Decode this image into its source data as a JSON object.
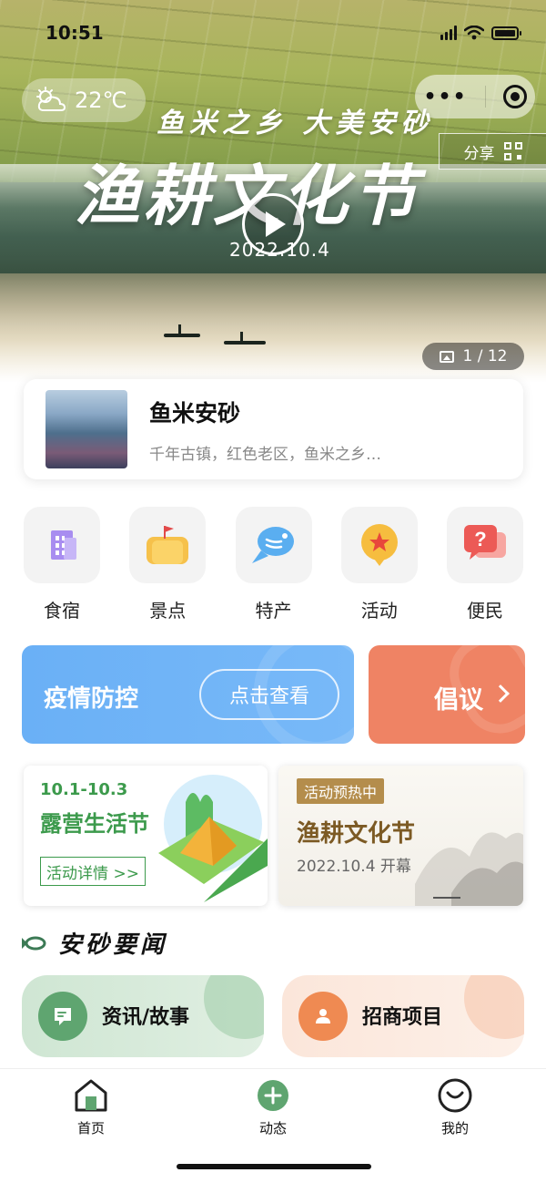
{
  "status_bar": {
    "time": "10:51"
  },
  "hero": {
    "weather_temp": "22℃",
    "share_label": "分享",
    "slogan": "鱼米之乡 大美安砂",
    "title": "渔耕文化节",
    "date": "2022.10.4",
    "image_counter": "1 / 12"
  },
  "intro": {
    "name": "鱼米安砂",
    "description": "千年古镇，红色老区，鱼米之乡…"
  },
  "categories": [
    {
      "label": "食宿",
      "icon": "building-icon"
    },
    {
      "label": "景点",
      "icon": "flag-icon"
    },
    {
      "label": "特产",
      "icon": "fish-icon"
    },
    {
      "label": "活动",
      "icon": "star-badge-icon"
    },
    {
      "label": "便民",
      "icon": "question-chat-icon"
    }
  ],
  "banners": {
    "epidemic_title": "疫情防控",
    "epidemic_button": "点击查看",
    "proposal_title": "倡议"
  },
  "events": [
    {
      "dates": "10.1-10.3",
      "name": "露营生活节",
      "button": "活动详情 >>"
    },
    {
      "tag": "活动预热中",
      "name": "渔耕文化节",
      "subtitle": "2022.10.4 开幕"
    }
  ],
  "news": {
    "section_title": "安砂要闻",
    "cards": [
      {
        "label": "资讯/故事"
      },
      {
        "label": "招商项目"
      }
    ]
  },
  "tabbar": {
    "items": [
      {
        "label": "首页"
      },
      {
        "label": "动态"
      },
      {
        "label": "我的"
      }
    ]
  },
  "colors": {
    "epidemic_blue": "#6ab0f6",
    "proposal_orange": "#ef8364",
    "camp_green": "#3c9a4c",
    "festival_brown": "#7c5a24"
  }
}
